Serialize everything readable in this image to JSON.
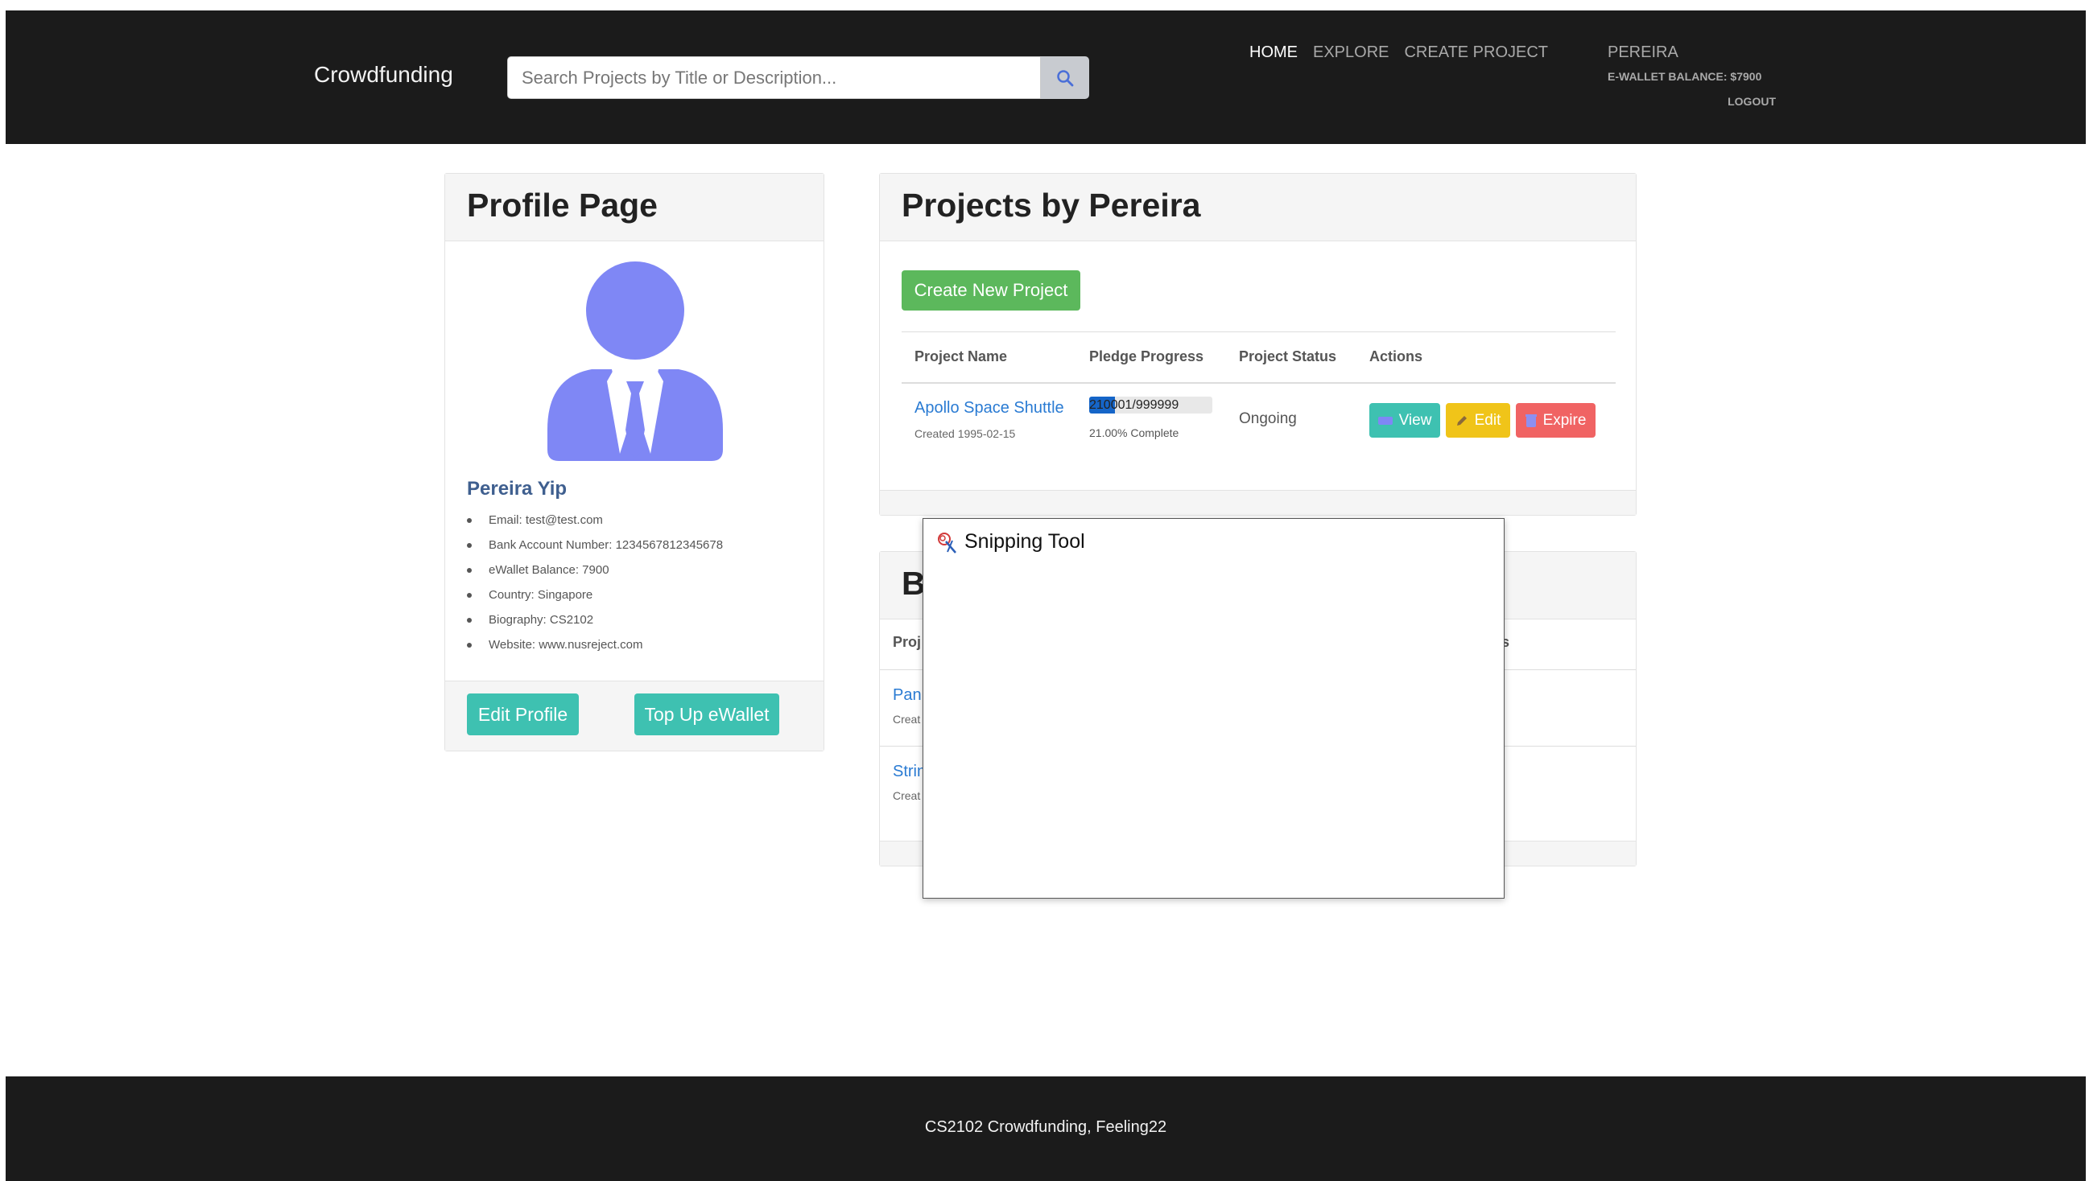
{
  "navbar": {
    "brand": "Crowdfunding",
    "search_placeholder": "Search Projects by Title or Description...",
    "links": [
      "HOME",
      "EXPLORE",
      "CREATE PROJECT"
    ],
    "user": "PEREIRA",
    "balance": "E-WALLET BALANCE: $7900",
    "logout": "LOGOUT"
  },
  "profile": {
    "title": "Profile Page",
    "name": "Pereira Yip",
    "details": [
      "Email: test@test.com",
      "Bank Account Number: 1234567812345678",
      "eWallet Balance: 7900",
      "Country: Singapore",
      "Biography: CS2102",
      "Website: www.nusreject.com"
    ],
    "edit_label": "Edit Profile",
    "topup_label": "Top Up eWallet",
    "avatar_color": "#7f87f5"
  },
  "projects": {
    "title": "Projects by Pereira",
    "create_label": "Create New Project",
    "headers": [
      "Project Name",
      "Pledge Progress",
      "Project Status",
      "Actions"
    ],
    "row": {
      "name": "Apollo Space Shuttle",
      "created": "Created 1995-02-15",
      "progress_text": "210001/999999",
      "progress_fraction": 0.21,
      "complete": "21.00% Complete",
      "status": "Ongoing",
      "view": "View",
      "edit": "Edit",
      "expire": "Expire"
    }
  },
  "backed": {
    "title_partial": "B",
    "header_partial": "Proj",
    "header_right_partial": "s",
    "rows": [
      {
        "name": "Pan",
        "created": "Creat"
      },
      {
        "name": "Strin",
        "created": "Creat"
      }
    ]
  },
  "snipping_tool": {
    "title": "Snipping Tool"
  },
  "footer": {
    "text": "CS2102 Crowdfunding, Feeling22"
  },
  "colors": {
    "navbar": "#1b1b1b",
    "teal": "#3ec1b1",
    "green": "#5cb85c",
    "yellow": "#f0c419",
    "red": "#f06363",
    "link": "#2a7bd3",
    "progress": "#1565c8"
  }
}
